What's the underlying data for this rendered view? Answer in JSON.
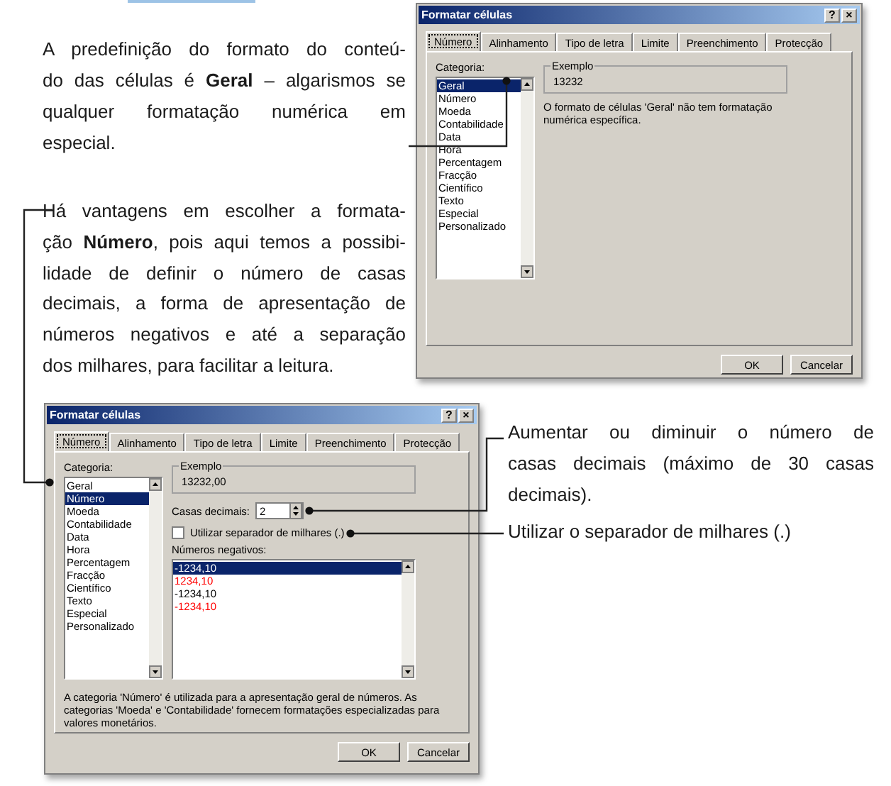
{
  "callouts": [
    {
      "lines": [
        "A predefinição do formato do conteú-",
        "do das células é **Geral** – algarismos se",
        "qualquer formatação numérica em",
        "especial."
      ]
    },
    {
      "lines": [
        "Há vantagens em escolher a formata-",
        "ção **Número**, pois aqui temos a possibi-",
        "lidade de definir o número de casas",
        "decimais, a forma de apresentação de",
        "números negativos e até a separação",
        "dos milhares, para facilitar a leitura."
      ]
    },
    {
      "lines": [
        "Aumentar ou diminuir o número de",
        "casas decimais (máximo de 30 casas",
        "decimais)."
      ]
    },
    {
      "lines": [
        "Utilizar o separador de milhares (.)"
      ]
    }
  ],
  "dialogs": [
    {
      "title": "Formatar células",
      "title_buttons": [
        "?",
        "×"
      ],
      "tabs": [
        {
          "label": "Número",
          "selected": true
        },
        {
          "label": "Alinhamento",
          "selected": false
        },
        {
          "label": "Tipo de letra",
          "selected": false
        },
        {
          "label": "Limite",
          "selected": false
        },
        {
          "label": "Preenchimento",
          "selected": false
        },
        {
          "label": "Protecção",
          "selected": false
        }
      ],
      "category_label": "Categoria:",
      "categories": [
        {
          "label": "Geral",
          "selected": true
        },
        {
          "label": "Número",
          "selected": false
        },
        {
          "label": "Moeda",
          "selected": false
        },
        {
          "label": "Contabilidade",
          "selected": false
        },
        {
          "label": "Data",
          "selected": false
        },
        {
          "label": "Hora",
          "selected": false
        },
        {
          "label": "Percentagem",
          "selected": false
        },
        {
          "label": "Fracção",
          "selected": false
        },
        {
          "label": "Científico",
          "selected": false
        },
        {
          "label": "Texto",
          "selected": false
        },
        {
          "label": "Especial",
          "selected": false
        },
        {
          "label": "Personalizado",
          "selected": false
        }
      ],
      "sample_label": "Exemplo",
      "sample_value": "13232",
      "description": "O formato de células 'Geral' não tem formatação numérica específica.",
      "buttons": [
        "OK",
        "Cancelar"
      ]
    },
    {
      "title": "Formatar células",
      "title_buttons": [
        "?",
        "×"
      ],
      "tabs": [
        {
          "label": "Número",
          "selected": true
        },
        {
          "label": "Alinhamento",
          "selected": false
        },
        {
          "label": "Tipo de letra",
          "selected": false
        },
        {
          "label": "Limite",
          "selected": false
        },
        {
          "label": "Preenchimento",
          "selected": false
        },
        {
          "label": "Protecção",
          "selected": false
        }
      ],
      "category_label": "Categoria:",
      "categories": [
        {
          "label": "Geral",
          "selected": false
        },
        {
          "label": "Número",
          "selected": true
        },
        {
          "label": "Moeda",
          "selected": false
        },
        {
          "label": "Contabilidade",
          "selected": false
        },
        {
          "label": "Data",
          "selected": false
        },
        {
          "label": "Hora",
          "selected": false
        },
        {
          "label": "Percentagem",
          "selected": false
        },
        {
          "label": "Fracção",
          "selected": false
        },
        {
          "label": "Científico",
          "selected": false
        },
        {
          "label": "Texto",
          "selected": false
        },
        {
          "label": "Especial",
          "selected": false
        },
        {
          "label": "Personalizado",
          "selected": false
        }
      ],
      "sample_label": "Exemplo",
      "sample_value": "13232,00",
      "decimal_places": {
        "label": "Casas decimais:",
        "value": "2"
      },
      "thousands_separator": {
        "label": "Utilizar separador de milhares (.)",
        "checked": false
      },
      "negative_numbers": {
        "label": "Números negativos:",
        "items": [
          {
            "text": "-1234,10",
            "selected": true
          },
          {
            "text": "1234,10",
            "selected": false,
            "color": "#ff0000"
          },
          {
            "text": "-1234,10",
            "selected": false,
            "color": "#000000"
          },
          {
            "text": "-1234,10",
            "selected": false,
            "color": "#ff0000"
          }
        ]
      },
      "description": "A categoria 'Número' é utilizada para a apresentação geral de números. As categorias 'Moeda' e 'Contabilidade' fornecem formatações especializadas para valores monetários.",
      "buttons": [
        "OK",
        "Cancelar"
      ]
    }
  ]
}
